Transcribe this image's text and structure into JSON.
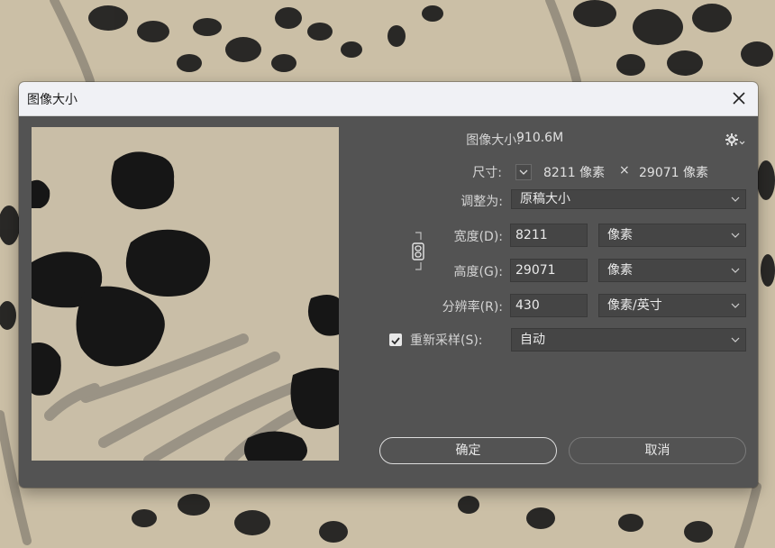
{
  "dialog": {
    "title": "图像大小",
    "close_glyph": "✕"
  },
  "info": {
    "image_size_label": "图像大小:",
    "image_size_value": "910.6M",
    "dimensions_label": "尺寸:",
    "dim_width": "8211 像素",
    "dim_times": "×",
    "dim_height": "29071 像素"
  },
  "form": {
    "fit_to_label": "调整为:",
    "fit_to_value": "原稿大小",
    "width_label": "宽度(D):",
    "width_value": "8211",
    "width_unit": "像素",
    "height_label": "高度(G):",
    "height_value": "29071",
    "height_unit": "像素",
    "resolution_label": "分辨率(R):",
    "resolution_value": "430",
    "resolution_unit": "像素/英寸",
    "resample_label": "重新采样(S):",
    "resample_checked": true,
    "resample_value": "自动"
  },
  "buttons": {
    "ok_label": "确定",
    "cancel_label": "取消"
  },
  "icons": {
    "settings": "gear-icon",
    "link": "chain-link-icon",
    "close": "close-icon",
    "dropdown": "chevron-down-icon"
  },
  "colors": {
    "dialog_bg": "#535353",
    "titlebar_bg": "#f0f1f5",
    "field_bg": "#454545",
    "text": "#d4d4d4"
  }
}
